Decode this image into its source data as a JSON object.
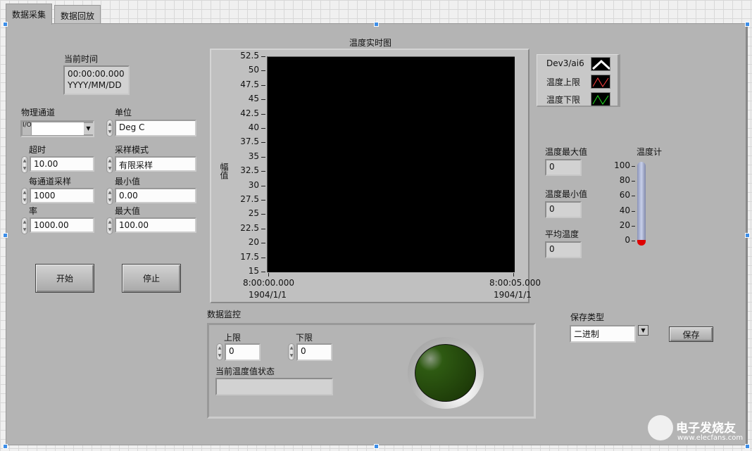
{
  "tabs": [
    {
      "label": "数据采集",
      "active": true
    },
    {
      "label": "数据回放",
      "active": false
    }
  ],
  "time": {
    "label": "当前时间",
    "line1": "00:00:00.000",
    "line2": "YYYY/MM/DD"
  },
  "channel": {
    "label": "物理通道",
    "value": "",
    "icon": "io-icon"
  },
  "unit": {
    "label": "单位",
    "value": "Deg C"
  },
  "timeout": {
    "label": "超时",
    "value": "10.00"
  },
  "mode": {
    "label": "采样模式",
    "value": "有限采样"
  },
  "samples": {
    "label": "每通道采样",
    "value": "1000"
  },
  "min": {
    "label": "最小值",
    "value": "0.00"
  },
  "rate": {
    "label": "率",
    "value": "1000.00"
  },
  "max": {
    "label": "最大值",
    "value": "100.00"
  },
  "buttons": {
    "start": "开始",
    "stop": "停止",
    "save": "保存"
  },
  "graph": {
    "title": "温度实时图",
    "ylabel": "幅值",
    "yticks": [
      "52.5",
      "50",
      "47.5",
      "45",
      "42.5",
      "40",
      "37.5",
      "35",
      "32.5",
      "30",
      "27.5",
      "25",
      "22.5",
      "20",
      "17.5",
      "15"
    ],
    "x_start": [
      "8:00:00.000",
      "1904/1/1"
    ],
    "x_end": [
      "8:00:05.000",
      "1904/1/1"
    ],
    "plot_bg": "#000000"
  },
  "legend": [
    {
      "label": "Dev3/ai6",
      "color": "#ffffff"
    },
    {
      "label": "温度上限",
      "color": "#ff4040"
    },
    {
      "label": "温度下限",
      "color": "#20e020"
    }
  ],
  "stats": [
    {
      "label": "温度最大值",
      "value": "0"
    },
    {
      "label": "温度最小值",
      "value": "0"
    },
    {
      "label": "平均温度",
      "value": "0"
    }
  ],
  "thermometer": {
    "label": "温度计",
    "ticks": [
      "100",
      "80",
      "60",
      "40",
      "20",
      "0"
    ],
    "value": 0
  },
  "monitor": {
    "label": "数据监控",
    "upper_label": "上限",
    "upper": "0",
    "lower_label": "下限",
    "lower": "0",
    "status_label": "当前温度值状态",
    "status": "",
    "led_on": false,
    "led_color": "#2a5a10"
  },
  "save_type": {
    "label": "保存类型",
    "value": "二进制"
  },
  "watermark": {
    "text": "电子发烧友",
    "url": "www.elecfans.com"
  }
}
